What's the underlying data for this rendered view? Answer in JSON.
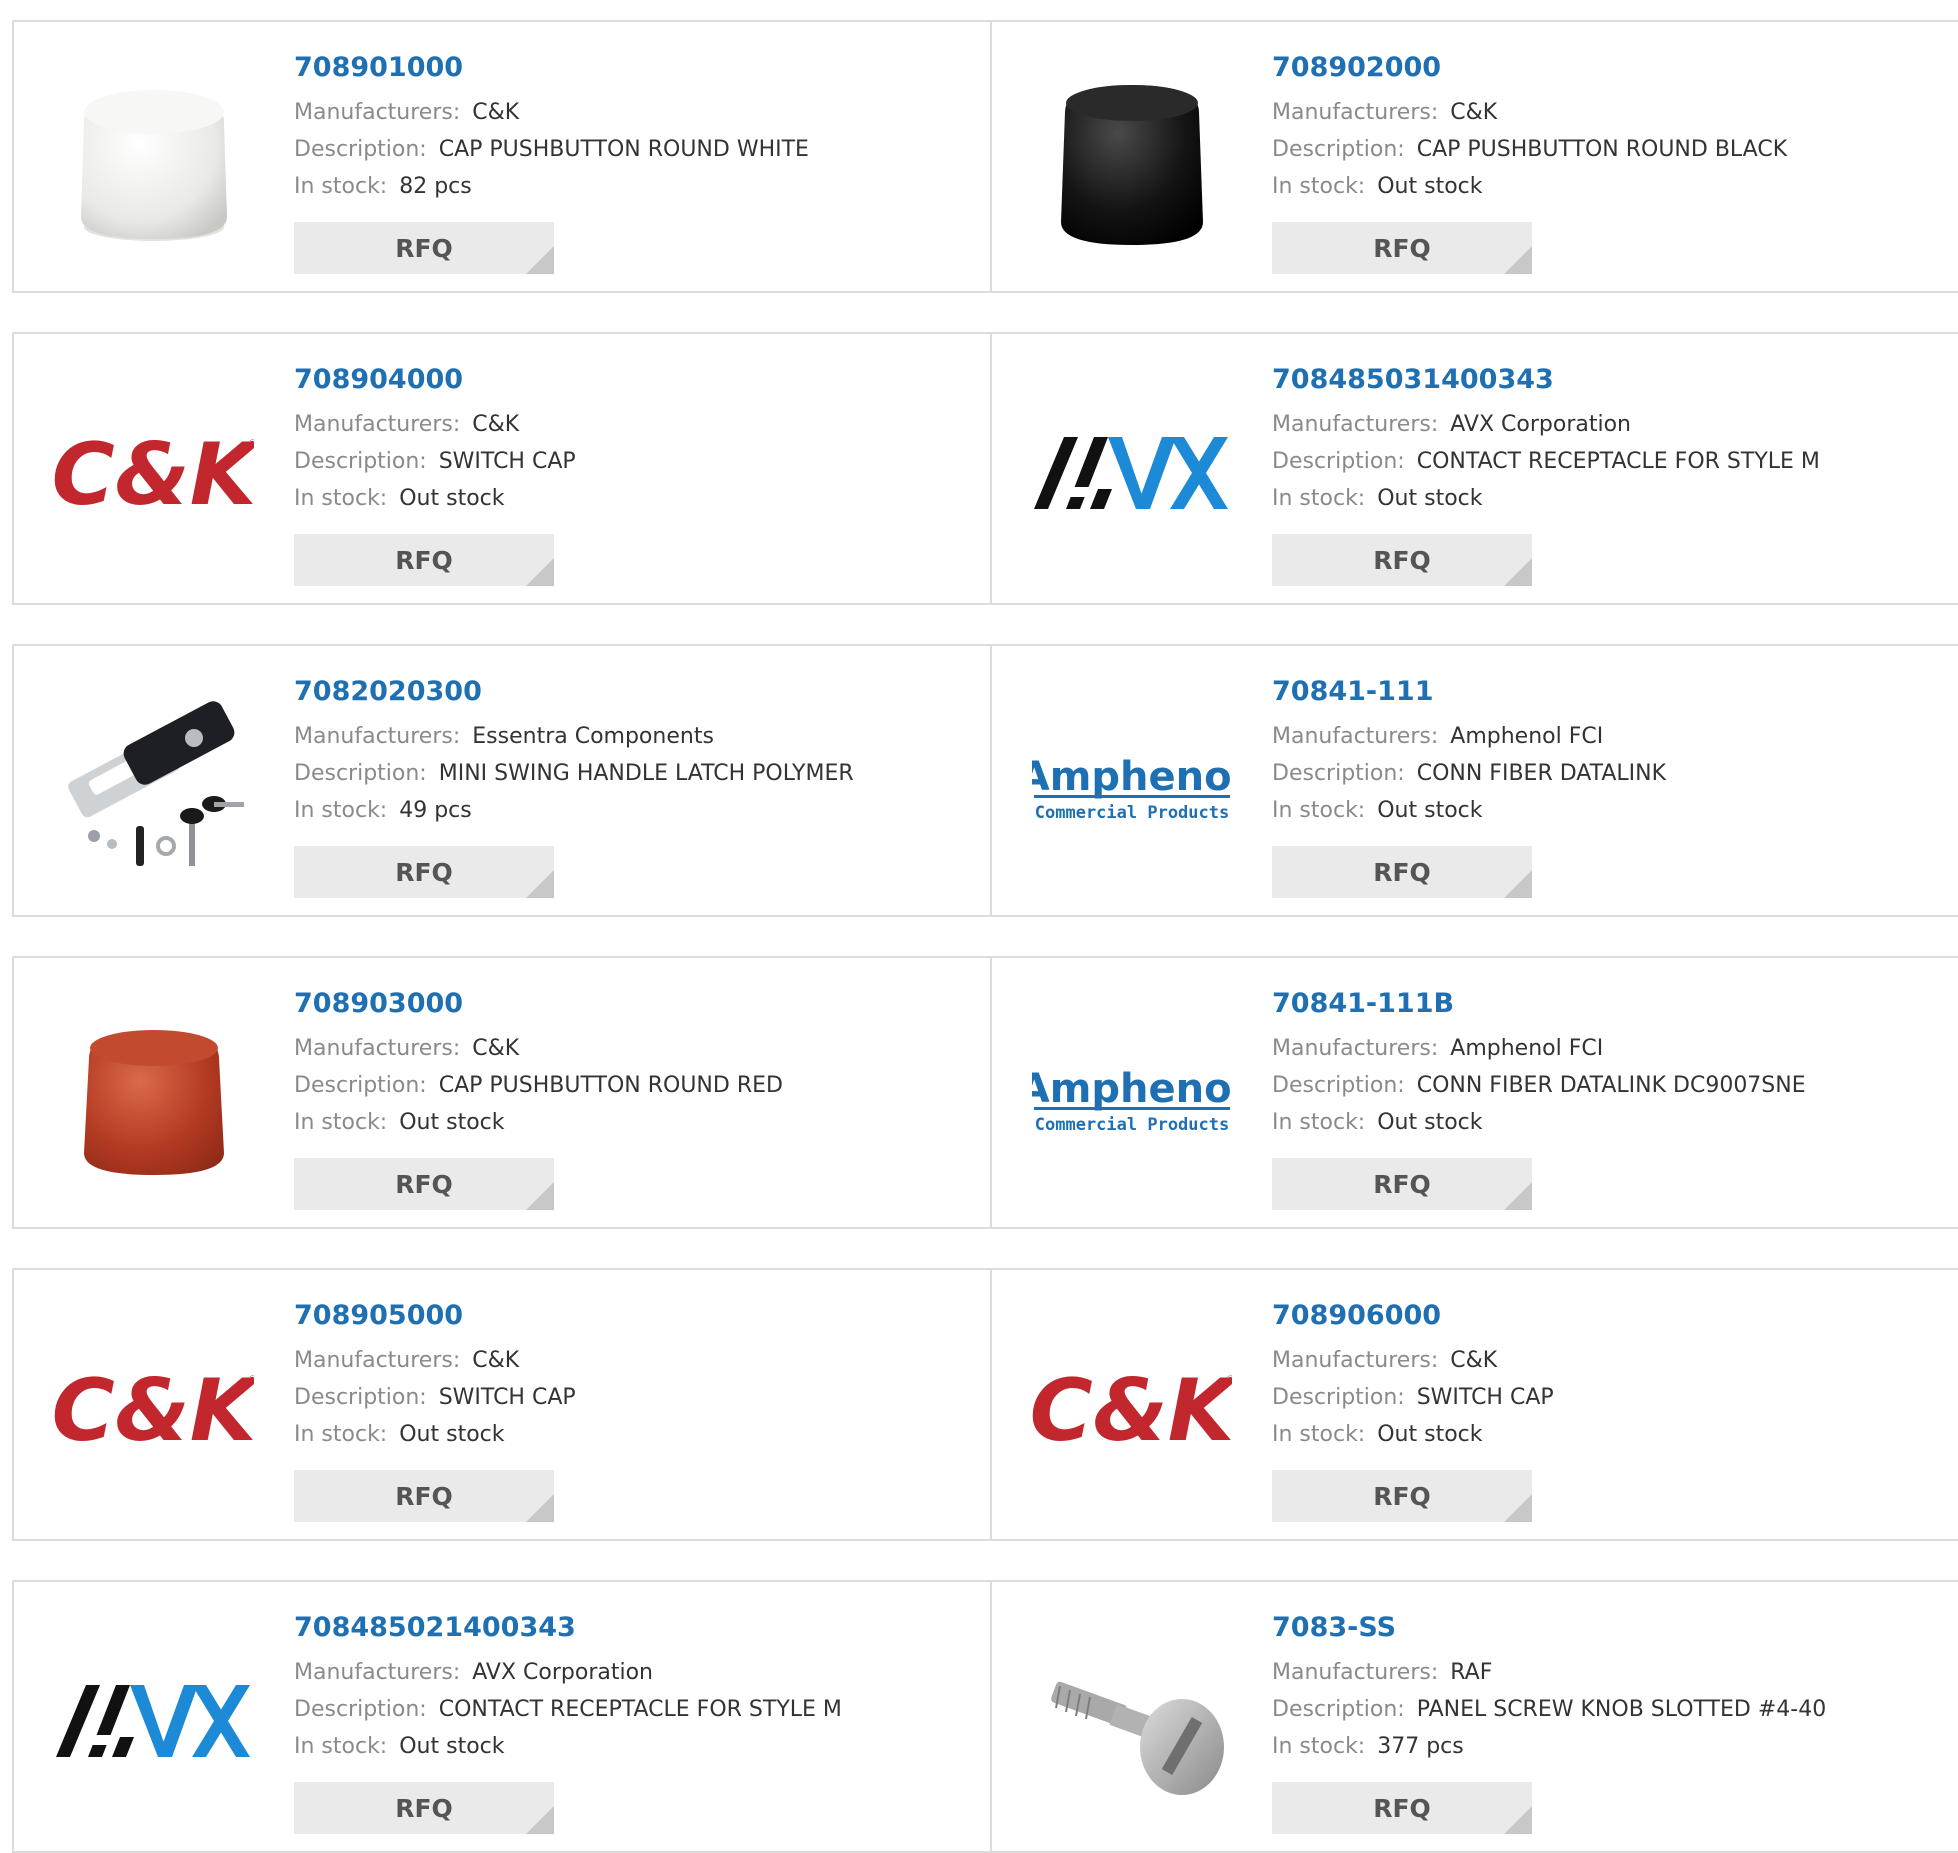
{
  "labels": {
    "manufacturer": "Manufacturers:",
    "description": "Description:",
    "stock": "In stock:",
    "rfq": "RFQ"
  },
  "logos": {
    "ck": "C&K",
    "avx": "AVX",
    "amphenol": "Amphenol",
    "amphenol_sub": "Commercial Products"
  },
  "colors": {
    "part_link": "#1f6fb3",
    "ck_red": "#c1272d",
    "avx_blue": "#1c8ad6",
    "amphenol_blue": "#1f6fb3"
  },
  "products": [
    {
      "part": "708901000",
      "manufacturer": "C&K",
      "description": "CAP PUSHBUTTON ROUND WHITE",
      "stock": "82 pcs",
      "image": "white-cap-image"
    },
    {
      "part": "708902000",
      "manufacturer": "C&K",
      "description": "CAP PUSHBUTTON ROUND BLACK",
      "stock": "Out stock",
      "image": "black-cap-image"
    },
    {
      "part": "708904000",
      "manufacturer": "C&K",
      "description": "SWITCH CAP",
      "stock": "Out stock",
      "image": "ck-logo"
    },
    {
      "part": "708485031400343",
      "manufacturer": "AVX Corporation",
      "description": "CONTACT RECEPTACLE FOR STYLE M",
      "stock": "Out stock",
      "image": "avx-logo"
    },
    {
      "part": "7082020300",
      "manufacturer": "Essentra Components",
      "description": "MINI SWING HANDLE LATCH POLYMER",
      "stock": "49 pcs",
      "image": "latch-image"
    },
    {
      "part": "70841-111",
      "manufacturer": "Amphenol FCI",
      "description": "CONN FIBER DATALINK",
      "stock": "Out stock",
      "image": "amphenol-logo"
    },
    {
      "part": "708903000",
      "manufacturer": "C&K",
      "description": "CAP PUSHBUTTON ROUND RED",
      "stock": "Out stock",
      "image": "red-cap-image"
    },
    {
      "part": "70841-111B",
      "manufacturer": "Amphenol FCI",
      "description": "CONN FIBER DATALINK DC9007SNE",
      "stock": "Out stock",
      "image": "amphenol-logo"
    },
    {
      "part": "708905000",
      "manufacturer": "C&K",
      "description": "SWITCH CAP",
      "stock": "Out stock",
      "image": "ck-logo"
    },
    {
      "part": "708906000",
      "manufacturer": "C&K",
      "description": "SWITCH CAP",
      "stock": "Out stock",
      "image": "ck-logo"
    },
    {
      "part": "708485021400343",
      "manufacturer": "AVX Corporation",
      "description": "CONTACT RECEPTACLE FOR STYLE M",
      "stock": "Out stock",
      "image": "avx-logo"
    },
    {
      "part": "7083-SS",
      "manufacturer": "RAF",
      "description": "PANEL SCREW KNOB SLOTTED #4-40",
      "stock": "377 pcs",
      "image": "screw-image"
    }
  ]
}
